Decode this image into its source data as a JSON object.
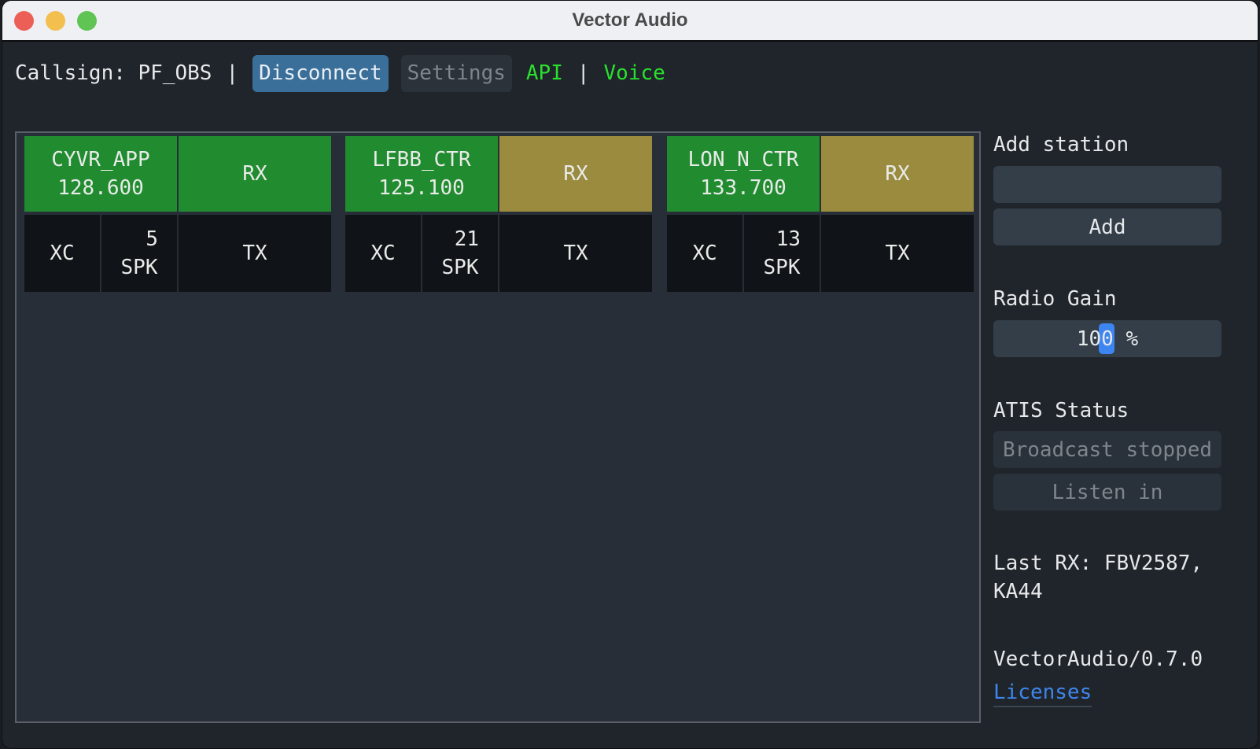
{
  "window": {
    "title": "Vector Audio"
  },
  "topbar": {
    "callsign_text": "Callsign: PF_OBS",
    "separator": "|",
    "disconnect_label": "Disconnect",
    "settings_label": "Settings",
    "api_label": "API",
    "voice_label": "Voice"
  },
  "stations": [
    {
      "callsign": "CYVR_APP",
      "frequency": "128.600",
      "rx_label": "RX",
      "rx_state": "active",
      "xc_label": "XC",
      "speakers_count": "5",
      "spk_label": "SPK",
      "tx_label": "TX"
    },
    {
      "callsign": "LFBB_CTR",
      "frequency": "125.100",
      "rx_label": "RX",
      "rx_state": "receiving",
      "xc_label": "XC",
      "speakers_count": "21",
      "spk_label": "SPK",
      "tx_label": "TX"
    },
    {
      "callsign": "LON_N_CTR",
      "frequency": "133.700",
      "rx_label": "RX",
      "rx_state": "receiving",
      "xc_label": "XC",
      "speakers_count": "13",
      "spk_label": "SPK",
      "tx_label": "TX"
    }
  ],
  "colors": {
    "rx_active": "#218b2f",
    "rx_receiving": "#9a8b3e",
    "accent_blue": "#3a6f9a",
    "link_green": "#29e12d",
    "link_blue": "#3e86ec"
  },
  "sidebar": {
    "add_station_label": "Add station",
    "add_station_value": "",
    "add_button_label": "Add",
    "radio_gain_label": "Radio Gain",
    "radio_gain_value": "100 %",
    "radio_gain_percent": 100,
    "atis_status_label": "ATIS Status",
    "atis_broadcast_status": "Broadcast stopped",
    "atis_listen_label": "Listen in",
    "last_rx_line1": "Last RX: FBV2587,",
    "last_rx_line2": "KA44",
    "version": "VectorAudio/0.7.0",
    "licenses_label": "Licenses"
  }
}
